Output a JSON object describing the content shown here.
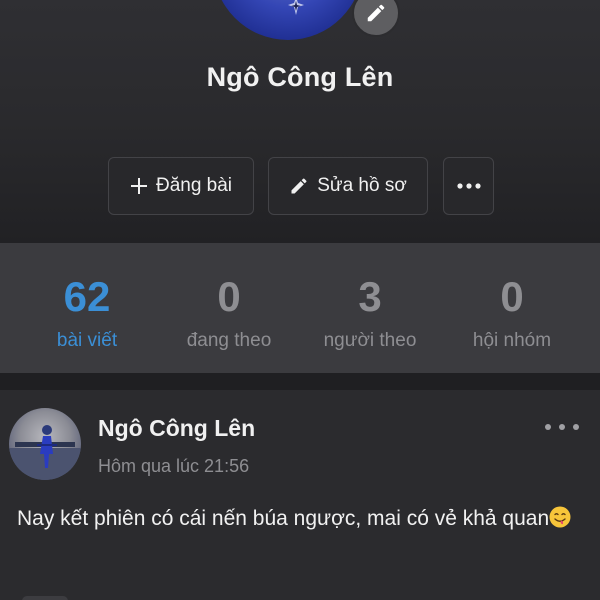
{
  "profile": {
    "name": "Ngô Công Lên",
    "avatar_icon": "profile-photo",
    "edit_avatar_icon": "pencil-icon"
  },
  "actions": {
    "post_label": "Đăng bài",
    "post_icon": "plus-icon",
    "edit_profile_label": "Sửa hồ sơ",
    "edit_profile_icon": "pencil-icon",
    "more_icon": "more-dots-icon"
  },
  "stats": [
    {
      "value": "62",
      "label": "bài viết",
      "active": true
    },
    {
      "value": "0",
      "label": "đang theo",
      "active": false
    },
    {
      "value": "3",
      "label": "người theo",
      "active": false
    },
    {
      "value": "0",
      "label": "hội nhóm",
      "active": false
    }
  ],
  "post": {
    "author": "Ngô Công Lên",
    "time": "Hôm qua lúc 21:56",
    "content": "Nay kết phiên có cái nến búa ngược, mai có vẻ khả quan",
    "emoji": "face-savoring-food-emoji",
    "options_icon": "more-dots-icon"
  },
  "colors": {
    "accent": "#3b8fd6",
    "background": "#1f1f22",
    "stats_bg": "#3b3b3f",
    "card_bg": "#2b2b2e"
  }
}
